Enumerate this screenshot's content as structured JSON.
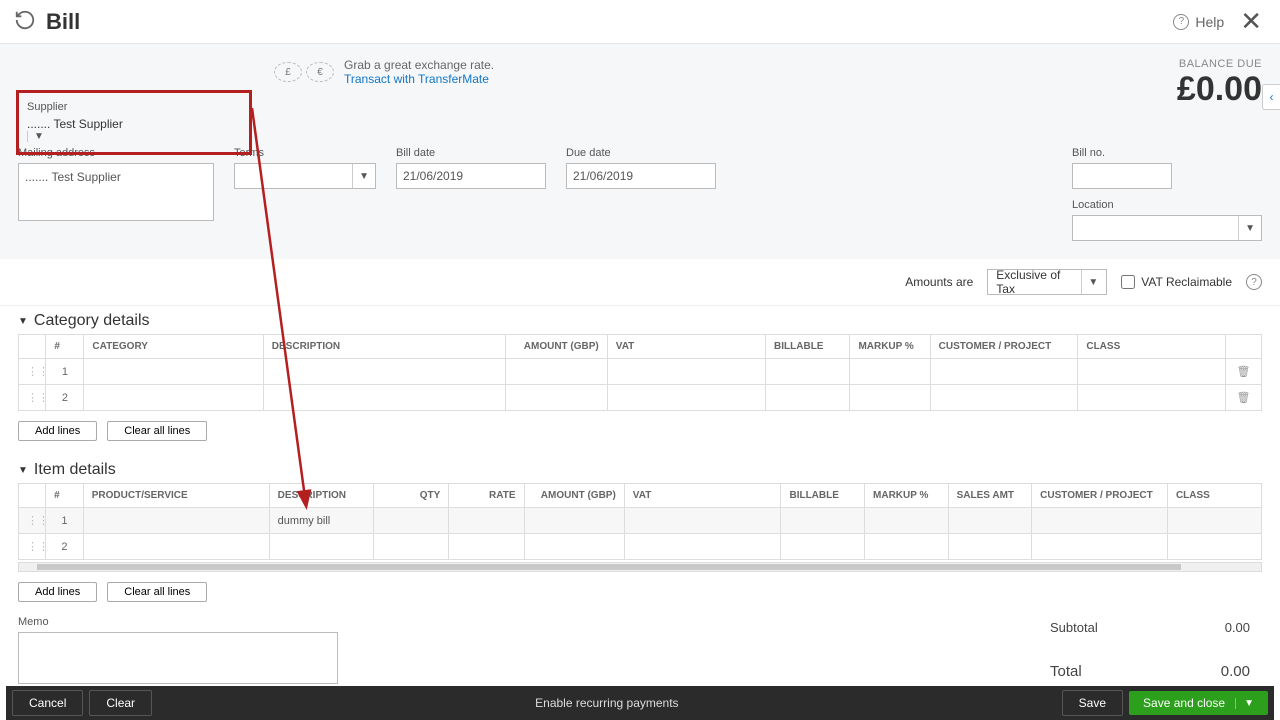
{
  "title": "Bill",
  "help": "Help",
  "promo": {
    "line1": "Grab a great exchange rate.",
    "link": "Transact with TransferMate"
  },
  "balance": {
    "label": "BALANCE DUE",
    "amount": "£0.00"
  },
  "fields": {
    "supplier_label": "Supplier",
    "supplier_value": "....... Test Supplier",
    "mailing_label": "Mailing address",
    "mailing_value": "....... Test Supplier",
    "terms_label": "Terms",
    "terms_value": "",
    "billdate_label": "Bill date",
    "billdate_value": "21/06/2019",
    "duedate_label": "Due date",
    "duedate_value": "21/06/2019",
    "billno_label": "Bill no.",
    "billno_value": "",
    "location_label": "Location",
    "location_value": ""
  },
  "amounts": {
    "label": "Amounts are",
    "value": "Exclusive of Tax",
    "vat_label": "VAT Reclaimable"
  },
  "category": {
    "title": "Category details",
    "cols": {
      "num": "#",
      "cat": "CATEGORY",
      "desc": "DESCRIPTION",
      "amt": "AMOUNT (GBP)",
      "vat": "VAT",
      "bill": "BILLABLE",
      "mark": "MARKUP %",
      "cust": "CUSTOMER / PROJECT",
      "cls": "CLASS"
    },
    "rows": [
      {
        "n": "1"
      },
      {
        "n": "2"
      }
    ]
  },
  "items": {
    "title": "Item details",
    "cols": {
      "num": "#",
      "ps": "PRODUCT/SERVICE",
      "desc": "DESCRIPTION",
      "qty": "QTY",
      "rate": "RATE",
      "amt": "AMOUNT (GBP)",
      "vat": "VAT",
      "bill": "BILLABLE",
      "mark": "MARKUP %",
      "sales": "SALES AMT",
      "cust": "CUSTOMER / PROJECT",
      "cls": "CLASS"
    },
    "rows": [
      {
        "n": "1",
        "desc": "dummy bill"
      },
      {
        "n": "2",
        "desc": ""
      }
    ]
  },
  "buttons": {
    "add": "Add lines",
    "clear": "Clear all lines"
  },
  "memo_label": "Memo",
  "totals": {
    "subtotal_l": "Subtotal",
    "subtotal_v": "0.00",
    "total_l": "Total",
    "total_v": "0.00"
  },
  "footer": {
    "cancel": "Cancel",
    "clear": "Clear",
    "center": "Enable recurring payments",
    "save": "Save",
    "primary": "Save and close"
  }
}
